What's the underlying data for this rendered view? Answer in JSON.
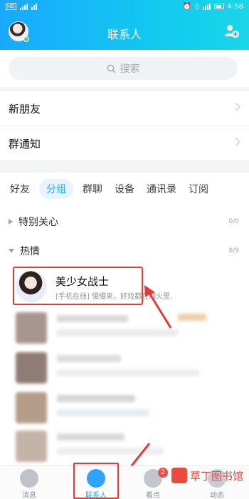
{
  "status_bar": {
    "left_chip": "HD",
    "time": "4:58"
  },
  "header": {
    "title": "联系人"
  },
  "search": {
    "placeholder": "搜索"
  },
  "rows": {
    "new_friends": "新朋友",
    "group_notice": "群通知"
  },
  "tabs": [
    "好友",
    "分组",
    "群聊",
    "设备",
    "通讯录",
    "订阅"
  ],
  "active_tab": "分组",
  "groups": [
    {
      "name": "特别关心",
      "count": "0/0",
      "expanded": false
    },
    {
      "name": "热情",
      "count": "8/9",
      "expanded": true
    }
  ],
  "contact": {
    "name": "美少女战士",
    "status": "[手机在线] 慢慢来，好戏都在烟火里."
  },
  "bottom_nav": {
    "items": [
      {
        "label": "消息"
      },
      {
        "label": "联系人"
      },
      {
        "label": "看点",
        "badge": "2"
      },
      {
        "label": "动态"
      }
    ]
  },
  "watermark": {
    "text": "草丁图书馆"
  },
  "colors": {
    "accent": "#2ea2ff",
    "header_start": "#1aa8ff",
    "highlight": "#e53935"
  }
}
